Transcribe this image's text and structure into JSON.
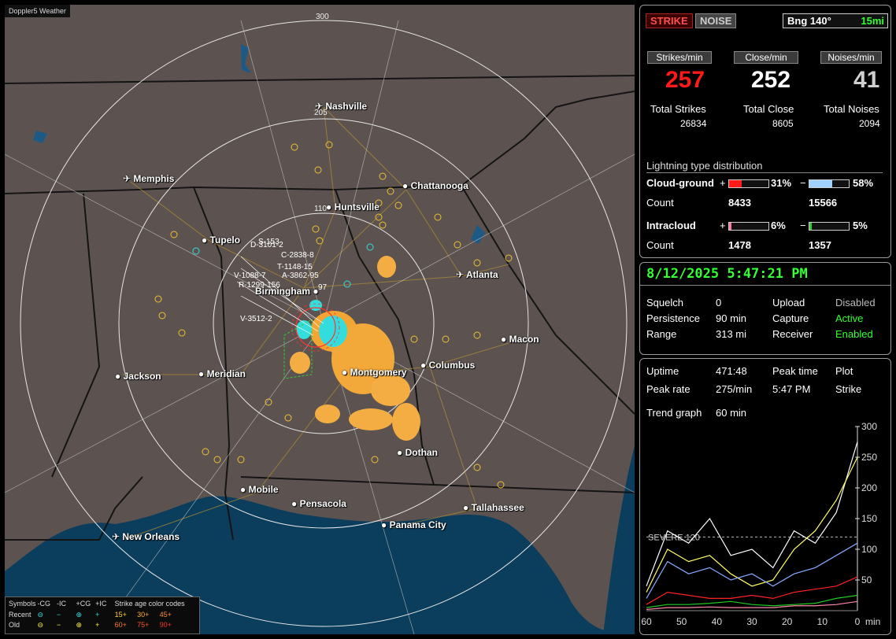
{
  "map": {
    "title": "Doppler5 Weather",
    "rings": [
      "300",
      "205",
      "110"
    ],
    "cities": [
      {
        "name": "Nashville",
        "airport": true
      },
      {
        "name": "Memphis",
        "airport": true
      },
      {
        "name": "Chattanooga",
        "airport": false
      },
      {
        "name": "Huntsville",
        "airport": false
      },
      {
        "name": "Tupelo",
        "airport": false
      },
      {
        "name": "Atlanta",
        "airport": true
      },
      {
        "name": "Birmingham",
        "airport": false
      },
      {
        "name": "Macon",
        "airport": false
      },
      {
        "name": "Jackson",
        "airport": true
      },
      {
        "name": "Meridian",
        "airport": false
      },
      {
        "name": "Montgomery",
        "airport": false
      },
      {
        "name": "Columbus",
        "airport": false
      },
      {
        "name": "Dothan",
        "airport": false
      },
      {
        "name": "Mobile",
        "airport": false
      },
      {
        "name": "Pensacola",
        "airport": false
      },
      {
        "name": "Tallahassee",
        "airport": false
      },
      {
        "name": "Panama City",
        "airport": false
      },
      {
        "name": "New Orleans",
        "airport": true
      }
    ],
    "storm_labels": [
      "S-153",
      "D-3101-2",
      "C-2838-8",
      "T-1148-15",
      "V-1088-7",
      "A-3862-95",
      "R-1299-156",
      "97",
      "V-3512-2"
    ]
  },
  "legend": {
    "symbols_label": "Symbols",
    "headers": [
      "-CG",
      "-IC",
      "+CG",
      "+IC"
    ],
    "rows": [
      {
        "label": "Recent",
        "symbols": [
          "⊖",
          "−",
          "⊕",
          "+"
        ]
      },
      {
        "label": "Old",
        "symbols": [
          "⊖",
          "−",
          "⊕",
          "+"
        ]
      }
    ],
    "age_title": "Strike age color codes",
    "age_recent": [
      "15+",
      "30+",
      "45+"
    ],
    "age_old": [
      "60+",
      "75+",
      "90+"
    ],
    "colors": {
      "recent": "#33dddd",
      "old": "#ffee44",
      "a15": "#ffcc33",
      "a30": "#ffaa33",
      "a45": "#ff8833",
      "a60": "#ff7722",
      "a75": "#ff5522",
      "a90": "#ff3322"
    }
  },
  "stats": {
    "strike_btn": "STRIKE",
    "noise_btn": "NOISE",
    "bearing": "Bng 140°",
    "range_mi": "15mi",
    "headers": [
      "Strikes/min",
      "Close/min",
      "Noises/min"
    ],
    "strikes_per_min": "257",
    "close_per_min": "252",
    "noises_per_min": "41",
    "total_labels": [
      "Total Strikes",
      "Total Close",
      "Total Noises"
    ],
    "totals": [
      "26834",
      "8605",
      "2094"
    ],
    "dist_title": "Lightning type distribution",
    "cloud_ground": {
      "label": "Cloud-ground",
      "pos_pct": "31%",
      "neg_pct": "58%",
      "pos_fill": 0.31,
      "neg_fill": 0.58
    },
    "cg_count_label": "Count",
    "cg_counts": [
      "8433",
      "15566"
    ],
    "intracloud": {
      "label": "Intracloud",
      "pos_pct": "6%",
      "neg_pct": "5%",
      "pos_fill": 0.06,
      "neg_fill": 0.05
    },
    "ic_count_label": "Count",
    "ic_counts": [
      "1478",
      "1357"
    ],
    "plus": "+",
    "minus": "−"
  },
  "status": {
    "datetime": "8/12/2025 5:47:21 PM",
    "rows": [
      {
        "k": "Squelch",
        "v": "0",
        "k2": "Upload",
        "v2": "Disabled",
        "v2_state": "grey"
      },
      {
        "k": "Persistence",
        "v": "90 min",
        "k2": "Capture",
        "v2": "Active",
        "v2_state": "green"
      },
      {
        "k": "Range",
        "v": "313 mi",
        "k2": "Receiver",
        "v2": "Enabled",
        "v2_state": "green"
      }
    ]
  },
  "trend": {
    "uptime_label": "Uptime",
    "uptime": "471:48",
    "peak_time_label": "Peak time",
    "peak_time": "5:47 PM",
    "plot_label": "Plot",
    "plot": "Strike",
    "peak_rate_label": "Peak rate",
    "peak_rate": "275/min",
    "graph_label": "Trend graph",
    "graph_range": "60 min",
    "severe_label": "SEVERE 120",
    "y_ticks": [
      "300",
      "250",
      "200",
      "150",
      "100",
      "50"
    ],
    "x_ticks": [
      "60",
      "50",
      "40",
      "30",
      "20",
      "10",
      "0"
    ],
    "x_unit": "min"
  },
  "chart_data": {
    "type": "line",
    "x": [
      60,
      54,
      48,
      42,
      36,
      30,
      24,
      18,
      12,
      6,
      0
    ],
    "ylim": [
      0,
      300
    ],
    "series": [
      {
        "color": "#ffffff",
        "values": [
          40,
          130,
          110,
          150,
          90,
          100,
          70,
          130,
          110,
          160,
          275
        ]
      },
      {
        "color": "#ffff66",
        "values": [
          30,
          100,
          80,
          90,
          60,
          40,
          50,
          100,
          130,
          180,
          250
        ]
      },
      {
        "color": "#88aaff",
        "values": [
          20,
          80,
          60,
          70,
          50,
          60,
          40,
          60,
          70,
          90,
          110
        ]
      },
      {
        "color": "#ff2222",
        "values": [
          10,
          30,
          25,
          20,
          20,
          25,
          20,
          30,
          35,
          40,
          55
        ]
      },
      {
        "color": "#22cc22",
        "values": [
          5,
          10,
          10,
          12,
          15,
          10,
          8,
          10,
          12,
          20,
          25
        ]
      },
      {
        "color": "#ff88aa",
        "values": [
          2,
          5,
          5,
          6,
          5,
          5,
          5,
          8,
          8,
          10,
          15
        ]
      }
    ]
  }
}
